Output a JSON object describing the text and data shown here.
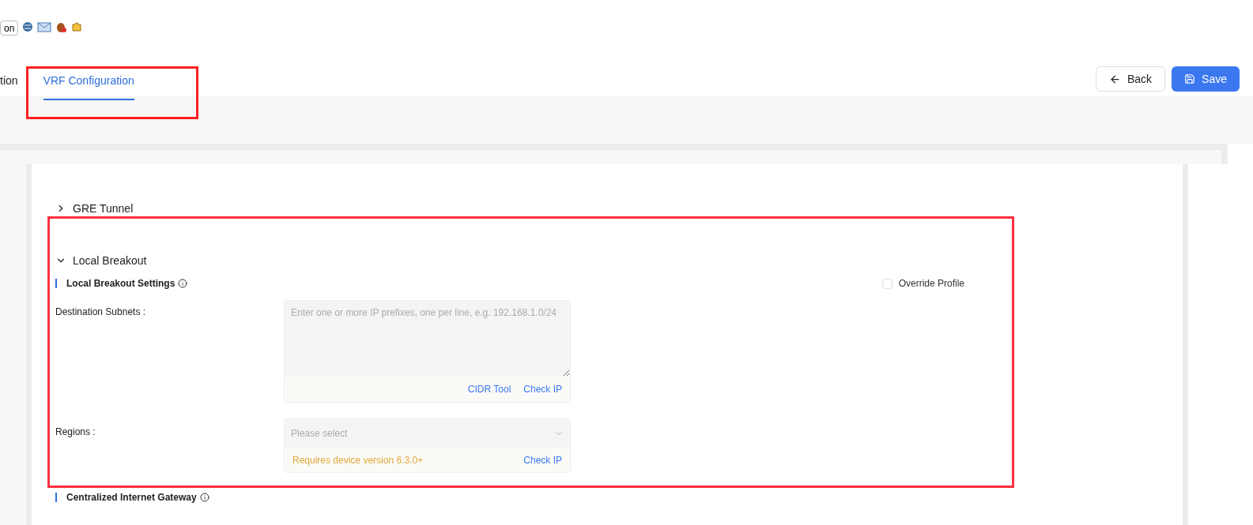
{
  "toolbar": {
    "button": "on"
  },
  "tabs": [
    {
      "label": "tion",
      "selected": false
    },
    {
      "label": "VRF Configuration",
      "selected": true
    }
  ],
  "actions": {
    "back": "Back",
    "save": "Save"
  },
  "sections": [
    {
      "title": "GRE Tunnel",
      "expanded": false
    },
    {
      "title": "Local Breakout",
      "expanded": true
    }
  ],
  "local_breakout": {
    "heading": "Local Breakout Settings",
    "override": {
      "label": "Override Profile",
      "checked": false
    },
    "destination": {
      "label": "Destination Subnets :",
      "placeholder": "Enter one or more IP prefixes, one per line, e.g. 192.168.1.0/24",
      "links": [
        "CIDR Tool",
        "Check IP"
      ]
    },
    "regions": {
      "label": "Regions :",
      "placeholder": "Please select",
      "note": "Requires device version 6.3.0+",
      "link": "Check IP"
    }
  },
  "next_heading": "Centralized Internet Gateway"
}
